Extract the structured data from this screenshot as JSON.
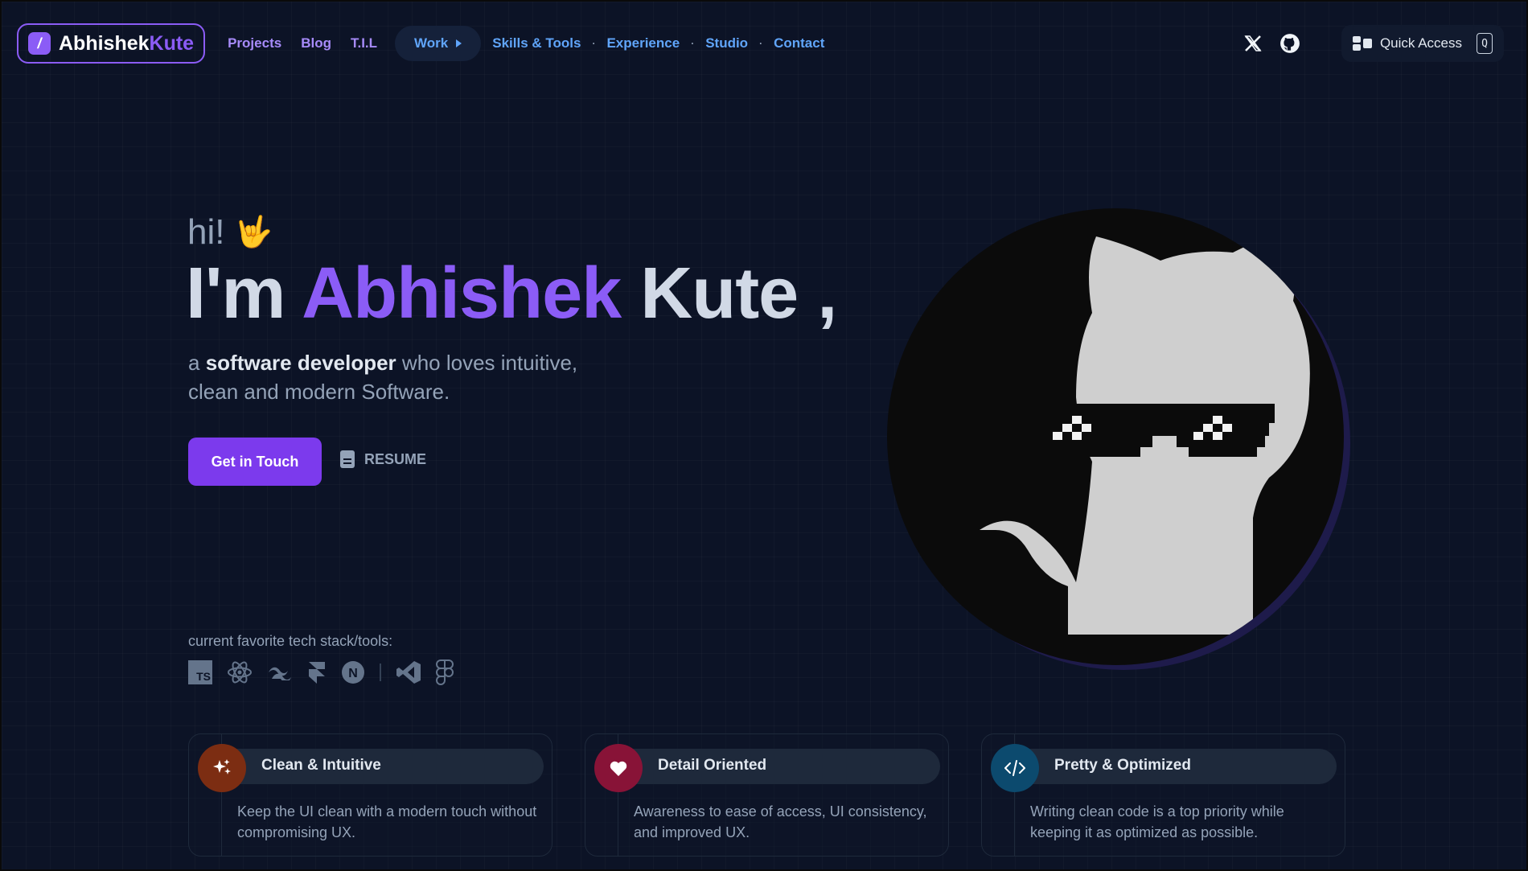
{
  "nav": {
    "logo_first": "Abhishek",
    "logo_second": "Kute",
    "links": [
      "Projects",
      "Blog",
      "T.I.L"
    ],
    "work_label": "Work",
    "links_right": [
      "Skills & Tools",
      "Experience",
      "Studio",
      "Contact"
    ],
    "dot": "·",
    "quick_access_label": "Quick Access",
    "quick_access_key": "Q"
  },
  "hero": {
    "greeting": "hi!",
    "greeting_emoji": "🤟",
    "headline_pre": "I'm",
    "headline_name": "Abhishek",
    "headline_last": "Kute",
    "headline_comma": ",",
    "sub_a": "a",
    "sub_bold": "software developer",
    "sub_rest": "who loves intuitive,",
    "sub_line2": "clean and modern Software.",
    "cta_label": "Get in Touch",
    "resume_label": "RESUME"
  },
  "stack": {
    "label": "current favorite tech stack/tools:",
    "ts": "TS",
    "next": "N",
    "icons": [
      "typescript-icon",
      "react-icon",
      "tailwind-icon",
      "framer-icon",
      "nextjs-icon",
      "vscode-icon",
      "figma-icon"
    ]
  },
  "cards": [
    {
      "title": "Clean & Intuitive",
      "desc": "Keep the UI clean with a modern touch without compromising UX.",
      "color": "#7c2d12",
      "icon": "sparkles-icon"
    },
    {
      "title": "Detail Oriented",
      "desc": "Awareness to ease of access, UI consistency, and improved UX.",
      "color": "#881337",
      "icon": "heart-icon"
    },
    {
      "title": "Pretty & Optimized",
      "desc": "Writing clean code is a top priority while keeping it as optimized as possible.",
      "color": "#0c4a6e",
      "icon": "code-icon"
    }
  ],
  "colors": {
    "accent": "#8b5cf6",
    "link_blue": "#60a5fa",
    "bg": "#0c1326"
  }
}
